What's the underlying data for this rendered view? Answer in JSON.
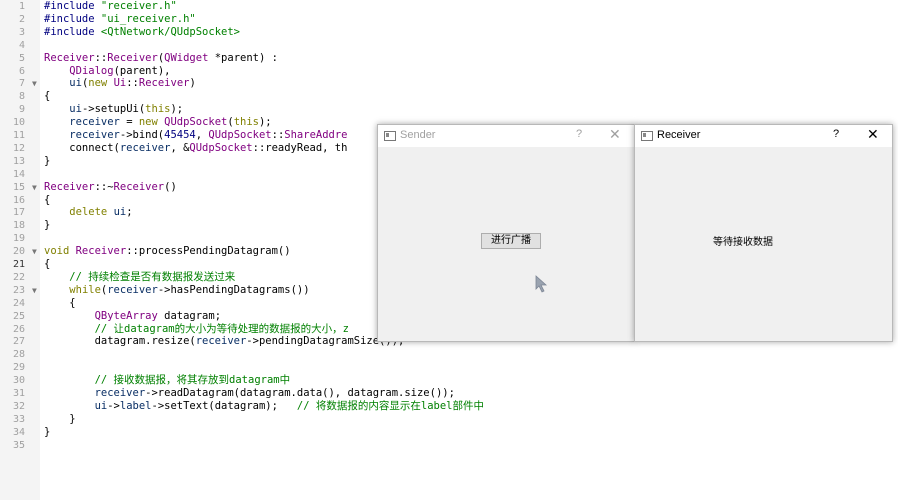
{
  "editor": {
    "lines": [
      {
        "n": "1",
        "fold": "",
        "parts": [
          [
            "pp",
            "#include "
          ],
          [
            "str",
            "\"receiver.h\""
          ]
        ]
      },
      {
        "n": "2",
        "fold": "",
        "parts": [
          [
            "pp",
            "#include "
          ],
          [
            "str",
            "\"ui_receiver.h\""
          ]
        ]
      },
      {
        "n": "3",
        "fold": "",
        "parts": [
          [
            "pp",
            "#include "
          ],
          [
            "str",
            "<QtNetwork/QUdpSocket>"
          ]
        ]
      },
      {
        "n": "4",
        "fold": "",
        "parts": []
      },
      {
        "n": "5",
        "fold": "",
        "parts": [
          [
            "cls",
            "Receiver"
          ],
          [
            "def",
            "::"
          ],
          [
            "cls",
            "Receiver"
          ],
          [
            "def",
            "("
          ],
          [
            "cls",
            "QWidget"
          ],
          [
            "def",
            " *parent) :"
          ]
        ]
      },
      {
        "n": "6",
        "fold": "",
        "parts": [
          [
            "def",
            "    "
          ],
          [
            "cls",
            "QDialog"
          ],
          [
            "def",
            "(parent),"
          ]
        ]
      },
      {
        "n": "7",
        "fold": "v",
        "parts": [
          [
            "def",
            "    "
          ],
          [
            "var",
            "ui"
          ],
          [
            "def",
            "("
          ],
          [
            "kw",
            "new "
          ],
          [
            "cls",
            "Ui"
          ],
          [
            "def",
            "::"
          ],
          [
            "cls",
            "Receiver"
          ],
          [
            "def",
            ")"
          ]
        ]
      },
      {
        "n": "8",
        "fold": "",
        "parts": [
          [
            "def",
            "{"
          ]
        ]
      },
      {
        "n": "9",
        "fold": "",
        "parts": [
          [
            "def",
            "    "
          ],
          [
            "var",
            "ui"
          ],
          [
            "def",
            "->setupUi("
          ],
          [
            "kw",
            "this"
          ],
          [
            "def",
            ");"
          ]
        ]
      },
      {
        "n": "10",
        "fold": "",
        "parts": [
          [
            "def",
            "    "
          ],
          [
            "var",
            "receiver"
          ],
          [
            "def",
            " = "
          ],
          [
            "kw",
            "new "
          ],
          [
            "cls",
            "QUdpSocket"
          ],
          [
            "def",
            "("
          ],
          [
            "kw",
            "this"
          ],
          [
            "def",
            ");"
          ]
        ]
      },
      {
        "n": "11",
        "fold": "",
        "parts": [
          [
            "def",
            "    "
          ],
          [
            "var",
            "receiver"
          ],
          [
            "def",
            "->bind("
          ],
          [
            "num",
            "45454"
          ],
          [
            "def",
            ", "
          ],
          [
            "cls",
            "QUdpSocket"
          ],
          [
            "def",
            "::"
          ],
          [
            "cls",
            "ShareAddre"
          ]
        ]
      },
      {
        "n": "12",
        "fold": "",
        "parts": [
          [
            "def",
            "    connect("
          ],
          [
            "var",
            "receiver"
          ],
          [
            "def",
            ", &"
          ],
          [
            "cls",
            "QUdpSocket"
          ],
          [
            "def",
            "::readyRead, th"
          ]
        ]
      },
      {
        "n": "13",
        "fold": "",
        "parts": [
          [
            "def",
            "}"
          ]
        ]
      },
      {
        "n": "14",
        "fold": "",
        "parts": []
      },
      {
        "n": "15",
        "fold": "v",
        "parts": [
          [
            "cls",
            "Receiver"
          ],
          [
            "def",
            "::~"
          ],
          [
            "cls",
            "Receiver"
          ],
          [
            "def",
            "()"
          ]
        ]
      },
      {
        "n": "16",
        "fold": "",
        "parts": [
          [
            "def",
            "{"
          ]
        ]
      },
      {
        "n": "17",
        "fold": "",
        "parts": [
          [
            "def",
            "    "
          ],
          [
            "kw",
            "delete "
          ],
          [
            "var",
            "ui"
          ],
          [
            "def",
            ";"
          ]
        ]
      },
      {
        "n": "18",
        "fold": "",
        "parts": [
          [
            "def",
            "}"
          ]
        ]
      },
      {
        "n": "19",
        "fold": "",
        "parts": []
      },
      {
        "n": "20",
        "fold": "v",
        "parts": [
          [
            "kw",
            "void "
          ],
          [
            "cls",
            "Receiver"
          ],
          [
            "def",
            "::"
          ],
          [
            "def",
            "processPendingDatagram()"
          ]
        ]
      },
      {
        "n": "21",
        "fold": "",
        "parts": [
          [
            "def",
            "{"
          ]
        ]
      },
      {
        "n": "22",
        "fold": "",
        "parts": [
          [
            "def",
            "    "
          ],
          [
            "cm",
            "// 持续检查是否有数据报发送过来"
          ]
        ]
      },
      {
        "n": "23",
        "fold": "v",
        "parts": [
          [
            "def",
            "    "
          ],
          [
            "kw",
            "while"
          ],
          [
            "def",
            "("
          ],
          [
            "var",
            "receiver"
          ],
          [
            "def",
            "->hasPendingDatagrams())"
          ]
        ]
      },
      {
        "n": "24",
        "fold": "",
        "parts": [
          [
            "def",
            "    {"
          ]
        ]
      },
      {
        "n": "25",
        "fold": "",
        "parts": [
          [
            "def",
            "        "
          ],
          [
            "cls",
            "QByteArray"
          ],
          [
            "def",
            " datagram;"
          ]
        ]
      },
      {
        "n": "26",
        "fold": "",
        "parts": [
          [
            "def",
            "        "
          ],
          [
            "cm",
            "// 让datagram的大小为等待处理的数据报的大小，z"
          ]
        ]
      },
      {
        "n": "27",
        "fold": "",
        "parts": [
          [
            "def",
            "        datagram.resize("
          ],
          [
            "var",
            "receiver"
          ],
          [
            "def",
            "->pendingDatagramSize());"
          ]
        ]
      },
      {
        "n": "28",
        "fold": "",
        "parts": []
      },
      {
        "n": "29",
        "fold": "",
        "parts": []
      },
      {
        "n": "30",
        "fold": "",
        "parts": [
          [
            "def",
            "        "
          ],
          [
            "cm",
            "// 接收数据报，将其存放到datagram中"
          ]
        ]
      },
      {
        "n": "31",
        "fold": "",
        "parts": [
          [
            "def",
            "        "
          ],
          [
            "var",
            "receiver"
          ],
          [
            "def",
            "->readDatagram(datagram.data(), datagram.size());"
          ]
        ]
      },
      {
        "n": "32",
        "fold": "",
        "parts": [
          [
            "def",
            "        "
          ],
          [
            "var",
            "ui"
          ],
          [
            "def",
            "->"
          ],
          [
            "var",
            "label"
          ],
          [
            "def",
            "->setText(datagram);   "
          ],
          [
            "cm",
            "// 将数据报的内容显示在label部件中"
          ]
        ]
      },
      {
        "n": "33",
        "fold": "",
        "parts": [
          [
            "def",
            "    }"
          ]
        ]
      },
      {
        "n": "34",
        "fold": "",
        "parts": [
          [
            "def",
            "}"
          ]
        ]
      },
      {
        "n": "35",
        "fold": "",
        "parts": []
      }
    ],
    "current_line": "21"
  },
  "sender_window": {
    "title": "Sender",
    "help": "?",
    "close": "✕",
    "broadcast_button": "进行广播"
  },
  "receiver_window": {
    "title": "Receiver",
    "help": "?",
    "close": "✕",
    "status_label": "等待接收数据"
  }
}
